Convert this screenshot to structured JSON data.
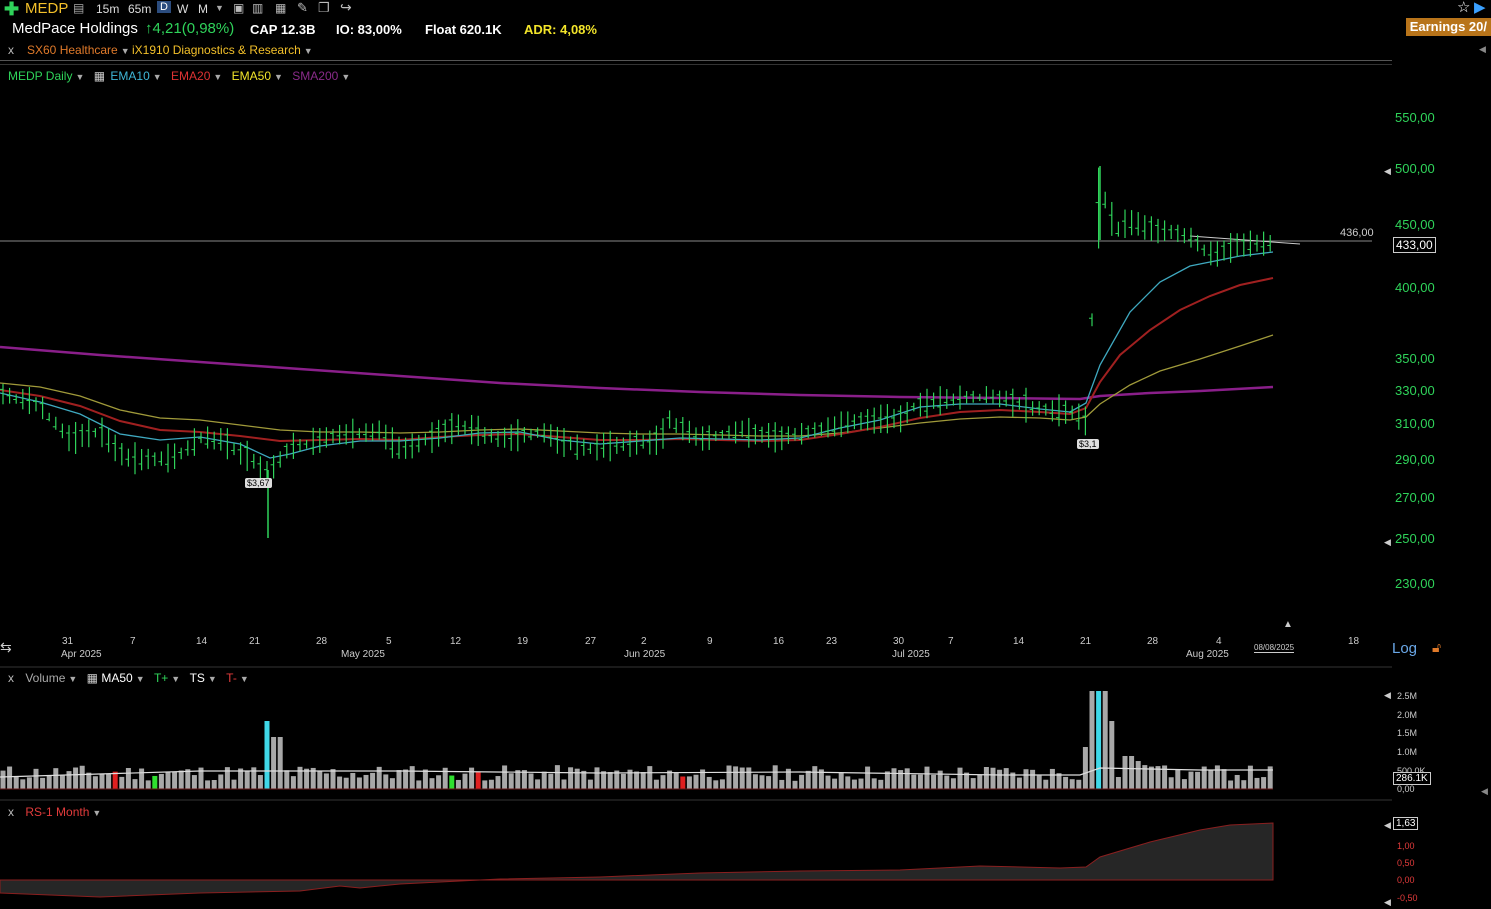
{
  "toolbar": {
    "symbol": "MEDP",
    "intervals": [
      "15m",
      "65m"
    ],
    "period_active": "D",
    "periods": [
      "W",
      "M"
    ]
  },
  "header": {
    "company": "MedPace Holdings",
    "change": "↑4,21(0,98%)",
    "cap": "CAP 12.3B",
    "io": "IO: 83,00%",
    "float": "Float 620.1K",
    "adr": "ADR: 4,08%",
    "earnings": "Earnings 20/"
  },
  "filters": {
    "close": "x",
    "sector": "SX60 Healthcare",
    "industry": "iX1910 Diagnostics & Research"
  },
  "legend": {
    "series": "MEDP Daily",
    "ema10": "EMA10",
    "ema20": "EMA20",
    "ema50": "EMA50",
    "sma200": "SMA200"
  },
  "colors": {
    "up": "#2fd35a",
    "ema10": "#3fa9c0",
    "ema20": "#a02020",
    "ema50": "#a09a3a",
    "sma200": "#8a1f8a",
    "accent_yellow": "#f3e52a",
    "rs": "#e23b3b"
  },
  "price_axis": {
    "ticks": [
      "550,00",
      "500,00",
      "450,00",
      "400,00",
      "350,00",
      "330,00",
      "310,00",
      "290,00",
      "270,00",
      "250,00",
      "230,00"
    ],
    "current_price": "433,00",
    "hline_label": "436,00",
    "scale": "Log"
  },
  "annotations": {
    "earn1": "$3,67",
    "earn2": "$3,1"
  },
  "x_axis": {
    "days": [
      "31",
      "7",
      "14",
      "21",
      "28",
      "5",
      "12",
      "19",
      "27",
      "2",
      "9",
      "16",
      "23",
      "30",
      "7",
      "14",
      "21",
      "28",
      "4",
      "18"
    ],
    "months": [
      "Apr 2025",
      "May 2025",
      "Jun 2025",
      "Jul 2025",
      "Aug 2025"
    ],
    "highlight_date": "08/08/2025"
  },
  "volume_pane": {
    "close": "x",
    "title": "Volume",
    "ma": "MA50",
    "t_plus": "T+",
    "ts": "TS",
    "t_minus": "T-",
    "ticks": [
      "2.5M",
      "2.0M",
      "1.5M",
      "1.0M",
      "500.0K",
      "0,00"
    ],
    "current": "286.1K"
  },
  "rs_pane": {
    "close": "x",
    "title": "RS-1 Month",
    "ticks": [
      "1,00",
      "0,50",
      "0,00",
      "-0,50"
    ],
    "current": "1,63"
  }
}
